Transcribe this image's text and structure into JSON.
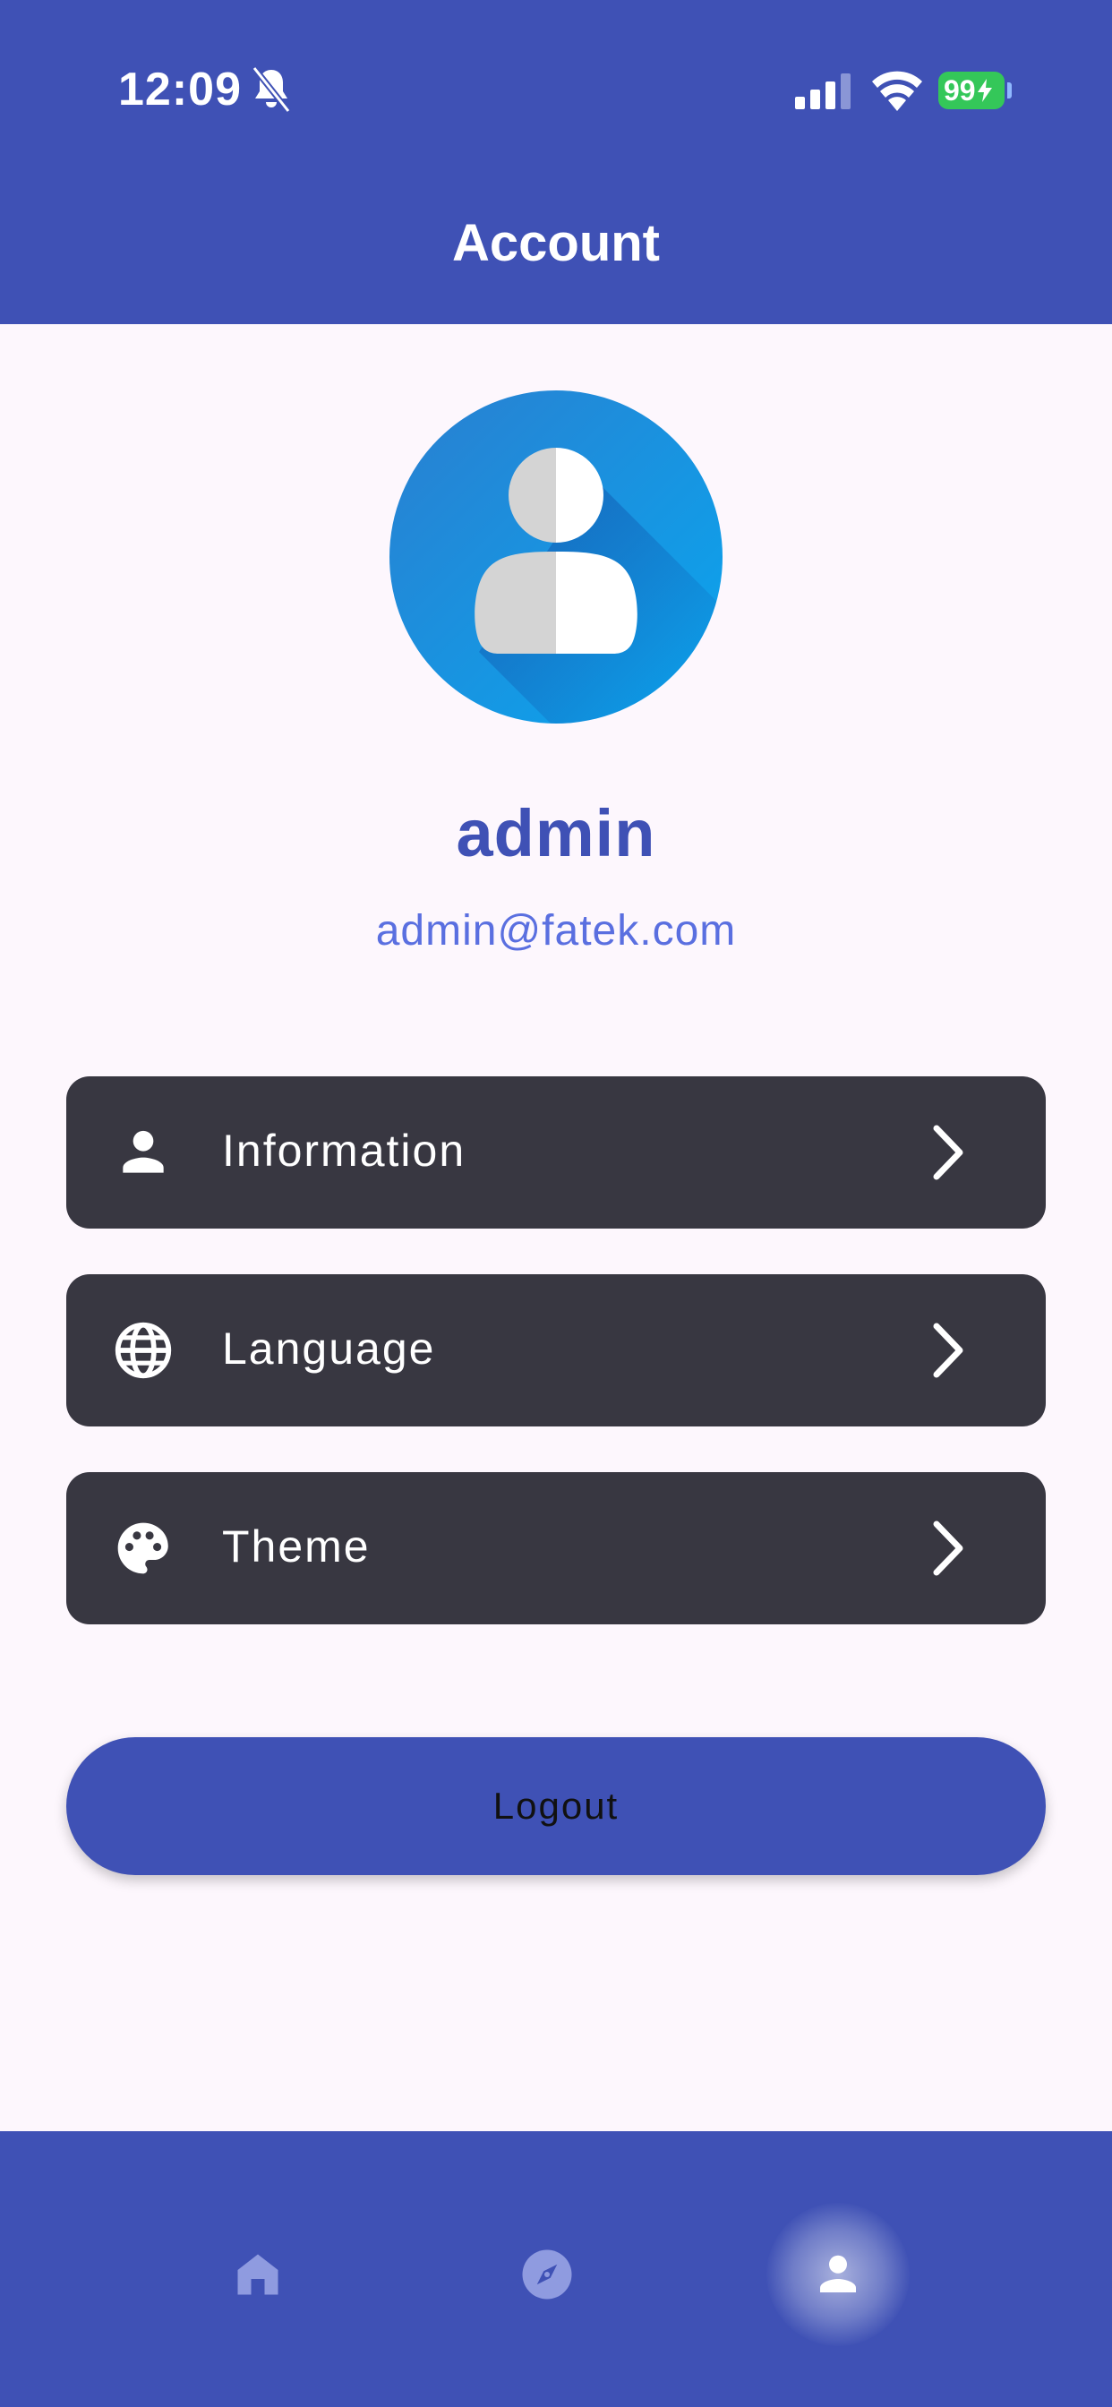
{
  "status_bar": {
    "time": "12:09",
    "battery": "99"
  },
  "header": {
    "title": "Account"
  },
  "profile": {
    "name": "admin",
    "email": "admin@fatek.com"
  },
  "menu": {
    "items": [
      {
        "label": "Information",
        "icon": "person-icon"
      },
      {
        "label": "Language",
        "icon": "globe-icon"
      },
      {
        "label": "Theme",
        "icon": "palette-icon"
      }
    ]
  },
  "logout": {
    "label": "Logout"
  },
  "bottom_nav": {
    "items": [
      {
        "icon": "home-icon",
        "active": false
      },
      {
        "icon": "compass-icon",
        "active": false
      },
      {
        "icon": "person-icon",
        "active": true
      }
    ]
  },
  "colors": {
    "primary": "#3f51b5",
    "background": "#fdf7fd",
    "card": "#383741",
    "email": "#5a6fe0",
    "battery": "#34c759"
  }
}
